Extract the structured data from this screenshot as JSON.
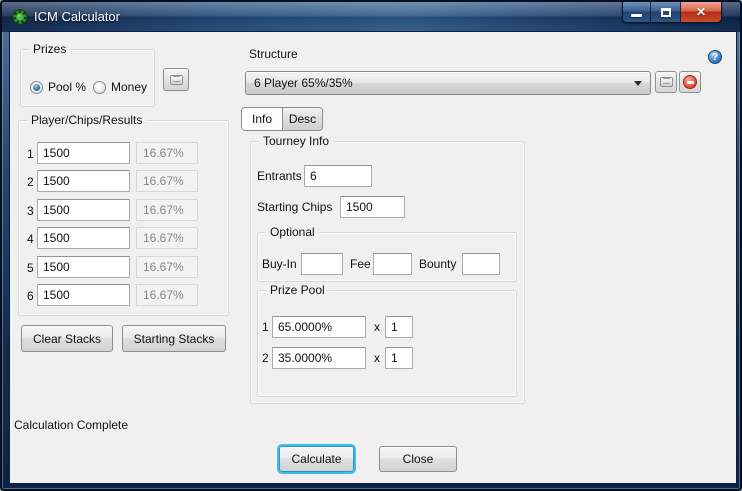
{
  "window": {
    "title": "ICM Calculator"
  },
  "icons": {
    "close_glyph": "✕",
    "help_glyph": "?"
  },
  "prizes": {
    "label": "Prizes",
    "pool_option": "Pool %",
    "money_option": "Money",
    "pool_selected": true,
    "money_selected": false
  },
  "players": {
    "label": "Player/Chips/Results",
    "rows": [
      {
        "num": "1",
        "chips": "1500",
        "result": "16.67%"
      },
      {
        "num": "2",
        "chips": "1500",
        "result": "16.67%"
      },
      {
        "num": "3",
        "chips": "1500",
        "result": "16.67%"
      },
      {
        "num": "4",
        "chips": "1500",
        "result": "16.67%"
      },
      {
        "num": "5",
        "chips": "1500",
        "result": "16.67%"
      },
      {
        "num": "6",
        "chips": "1500",
        "result": "16.67%"
      }
    ],
    "clear_button": "Clear Stacks",
    "starting_button": "Starting Stacks"
  },
  "structure": {
    "label": "Structure",
    "selected_option": "6 Player 65%/35%"
  },
  "tabs": {
    "info": "Info",
    "desc": "Desc"
  },
  "tourney": {
    "label": "Tourney Info",
    "entrants_label": "Entrants",
    "entrants_value": "6",
    "starting_chips_label": "Starting Chips",
    "starting_chips_value": "1500"
  },
  "optional": {
    "label": "Optional",
    "buyin_label": "Buy-In",
    "buyin_value": "",
    "fee_label": "Fee",
    "fee_value": "",
    "bounty_label": "Bounty",
    "bounty_value": ""
  },
  "prize_pool": {
    "label": "Prize Pool",
    "times_label": "x",
    "rows": [
      {
        "place": "1",
        "percent": "65.0000%",
        "multiplier": "1"
      },
      {
        "place": "2",
        "percent": "35.0000%",
        "multiplier": "1"
      }
    ]
  },
  "status": "Calculation Complete",
  "footer": {
    "calculate": "Calculate",
    "close": "Close"
  },
  "colors": {
    "titlebar_blue": "#26497a",
    "close_red": "#c84b2f",
    "focus_cyan": "#3fbde9",
    "chip_green": "#2e8f2e",
    "help_blue": "#2f6fb2",
    "client_bg": "#f0f0f0"
  }
}
